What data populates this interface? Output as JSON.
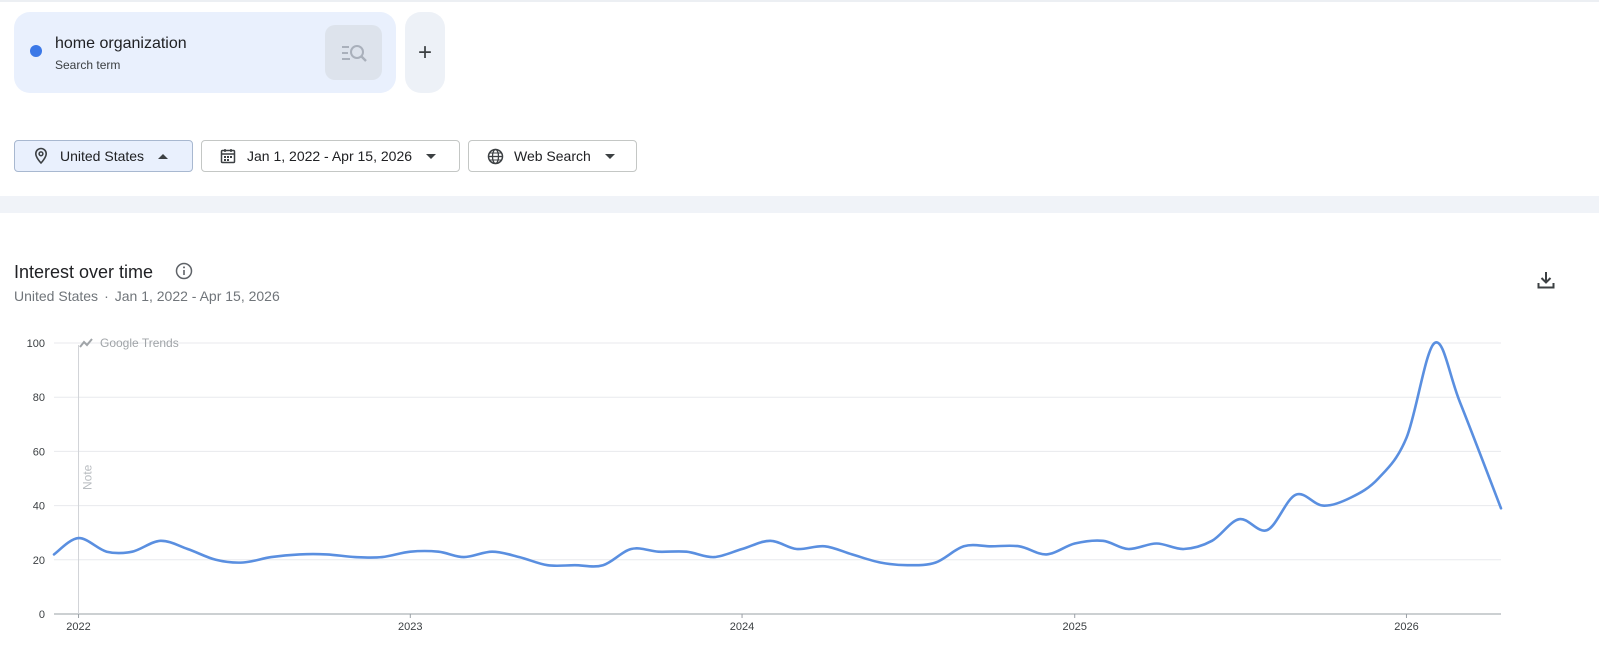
{
  "search_term": {
    "name": "home organization",
    "type": "Search term",
    "dot_color": "#3b78e7",
    "search_icon": "search-list-icon",
    "add_label": "+"
  },
  "filters": {
    "region": "United States",
    "date_range": "Jan 1, 2022 - Apr 15, 2026",
    "property": "Web Search"
  },
  "interest_over_time": {
    "title": "Interest over time",
    "subtitle_region": "United States",
    "subtitle_separator": "·",
    "subtitle_dates": "Jan 1, 2022 - Apr 15, 2026",
    "watermark": "Google Trends",
    "note_label": "Note"
  },
  "chart_data": {
    "type": "line",
    "x_range": [
      "2021-12-05",
      "2026-04-15"
    ],
    "ylim": [
      0,
      100
    ],
    "yticks": [
      0,
      20,
      40,
      60,
      80,
      100
    ],
    "xticks": [
      {
        "label": "2022",
        "date": "2022-01-01"
      },
      {
        "label": "2023",
        "date": "2023-01-01"
      },
      {
        "label": "2024",
        "date": "2024-01-01"
      },
      {
        "label": "2025",
        "date": "2025-01-01"
      },
      {
        "label": "2026",
        "date": "2026-01-01"
      }
    ],
    "note_date": "2022-01-01",
    "grid": true,
    "line_color": "#5a8fe0",
    "series": [
      {
        "name": "home organization",
        "points": [
          [
            "2021-12-05",
            22
          ],
          [
            "2022-01-01",
            28
          ],
          [
            "2022-02-01",
            23
          ],
          [
            "2022-03-01",
            23
          ],
          [
            "2022-04-01",
            27
          ],
          [
            "2022-05-01",
            24
          ],
          [
            "2022-06-01",
            20
          ],
          [
            "2022-07-01",
            19
          ],
          [
            "2022-08-01",
            21
          ],
          [
            "2022-09-01",
            22
          ],
          [
            "2022-10-01",
            22
          ],
          [
            "2022-11-01",
            21
          ],
          [
            "2022-12-01",
            21
          ],
          [
            "2023-01-01",
            23
          ],
          [
            "2023-02-01",
            23
          ],
          [
            "2023-03-01",
            21
          ],
          [
            "2023-04-01",
            23
          ],
          [
            "2023-05-01",
            21
          ],
          [
            "2023-06-01",
            18
          ],
          [
            "2023-07-01",
            18
          ],
          [
            "2023-08-01",
            18
          ],
          [
            "2023-09-01",
            24
          ],
          [
            "2023-10-01",
            23
          ],
          [
            "2023-11-01",
            23
          ],
          [
            "2023-12-01",
            21
          ],
          [
            "2024-01-01",
            24
          ],
          [
            "2024-02-01",
            27
          ],
          [
            "2024-03-01",
            24
          ],
          [
            "2024-04-01",
            25
          ],
          [
            "2024-05-01",
            22
          ],
          [
            "2024-06-01",
            19
          ],
          [
            "2024-07-01",
            18
          ],
          [
            "2024-08-01",
            19
          ],
          [
            "2024-09-01",
            25
          ],
          [
            "2024-10-01",
            25
          ],
          [
            "2024-11-01",
            25
          ],
          [
            "2024-12-01",
            22
          ],
          [
            "2025-01-01",
            26
          ],
          [
            "2025-02-01",
            27
          ],
          [
            "2025-03-01",
            24
          ],
          [
            "2025-04-01",
            26
          ],
          [
            "2025-05-01",
            24
          ],
          [
            "2025-06-01",
            27
          ],
          [
            "2025-07-01",
            35
          ],
          [
            "2025-08-01",
            31
          ],
          [
            "2025-09-01",
            44
          ],
          [
            "2025-10-01",
            40
          ],
          [
            "2025-11-01",
            43
          ],
          [
            "2025-12-01",
            50
          ],
          [
            "2026-01-01",
            65
          ],
          [
            "2026-02-01",
            100
          ],
          [
            "2026-03-01",
            78
          ],
          [
            "2026-04-15",
            39
          ]
        ]
      }
    ]
  }
}
